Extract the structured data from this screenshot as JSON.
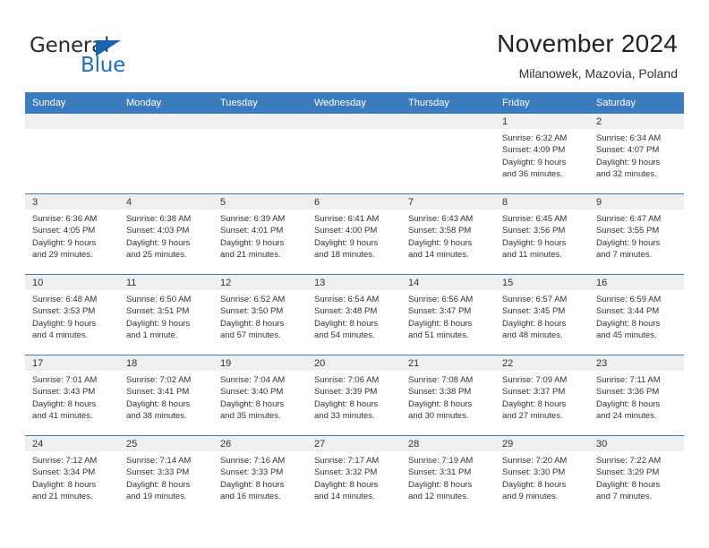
{
  "logo": {
    "word_general": "General",
    "word_blue": "Blue"
  },
  "header": {
    "title": "November 2024",
    "subtitle": "Milanowek, Mazovia, Poland"
  },
  "weekday_headers": [
    "Sunday",
    "Monday",
    "Tuesday",
    "Wednesday",
    "Thursday",
    "Friday",
    "Saturday"
  ],
  "colors": {
    "header_blue": "#3a7cbd",
    "logo_blue": "#1b6fc0",
    "daynum_band": "#efefef",
    "text": "#333333"
  },
  "weeks": [
    [
      {
        "day": "",
        "sunrise": "",
        "sunset": "",
        "daylight_line1": "",
        "daylight_line2": ""
      },
      {
        "day": "",
        "sunrise": "",
        "sunset": "",
        "daylight_line1": "",
        "daylight_line2": ""
      },
      {
        "day": "",
        "sunrise": "",
        "sunset": "",
        "daylight_line1": "",
        "daylight_line2": ""
      },
      {
        "day": "",
        "sunrise": "",
        "sunset": "",
        "daylight_line1": "",
        "daylight_line2": ""
      },
      {
        "day": "",
        "sunrise": "",
        "sunset": "",
        "daylight_line1": "",
        "daylight_line2": ""
      },
      {
        "day": "1",
        "sunrise": "Sunrise: 6:32 AM",
        "sunset": "Sunset: 4:09 PM",
        "daylight_line1": "Daylight: 9 hours",
        "daylight_line2": "and 36 minutes."
      },
      {
        "day": "2",
        "sunrise": "Sunrise: 6:34 AM",
        "sunset": "Sunset: 4:07 PM",
        "daylight_line1": "Daylight: 9 hours",
        "daylight_line2": "and 32 minutes."
      }
    ],
    [
      {
        "day": "3",
        "sunrise": "Sunrise: 6:36 AM",
        "sunset": "Sunset: 4:05 PM",
        "daylight_line1": "Daylight: 9 hours",
        "daylight_line2": "and 29 minutes."
      },
      {
        "day": "4",
        "sunrise": "Sunrise: 6:38 AM",
        "sunset": "Sunset: 4:03 PM",
        "daylight_line1": "Daylight: 9 hours",
        "daylight_line2": "and 25 minutes."
      },
      {
        "day": "5",
        "sunrise": "Sunrise: 6:39 AM",
        "sunset": "Sunset: 4:01 PM",
        "daylight_line1": "Daylight: 9 hours",
        "daylight_line2": "and 21 minutes."
      },
      {
        "day": "6",
        "sunrise": "Sunrise: 6:41 AM",
        "sunset": "Sunset: 4:00 PM",
        "daylight_line1": "Daylight: 9 hours",
        "daylight_line2": "and 18 minutes."
      },
      {
        "day": "7",
        "sunrise": "Sunrise: 6:43 AM",
        "sunset": "Sunset: 3:58 PM",
        "daylight_line1": "Daylight: 9 hours",
        "daylight_line2": "and 14 minutes."
      },
      {
        "day": "8",
        "sunrise": "Sunrise: 6:45 AM",
        "sunset": "Sunset: 3:56 PM",
        "daylight_line1": "Daylight: 9 hours",
        "daylight_line2": "and 11 minutes."
      },
      {
        "day": "9",
        "sunrise": "Sunrise: 6:47 AM",
        "sunset": "Sunset: 3:55 PM",
        "daylight_line1": "Daylight: 9 hours",
        "daylight_line2": "and 7 minutes."
      }
    ],
    [
      {
        "day": "10",
        "sunrise": "Sunrise: 6:48 AM",
        "sunset": "Sunset: 3:53 PM",
        "daylight_line1": "Daylight: 9 hours",
        "daylight_line2": "and 4 minutes."
      },
      {
        "day": "11",
        "sunrise": "Sunrise: 6:50 AM",
        "sunset": "Sunset: 3:51 PM",
        "daylight_line1": "Daylight: 9 hours",
        "daylight_line2": "and 1 minute."
      },
      {
        "day": "12",
        "sunrise": "Sunrise: 6:52 AM",
        "sunset": "Sunset: 3:50 PM",
        "daylight_line1": "Daylight: 8 hours",
        "daylight_line2": "and 57 minutes."
      },
      {
        "day": "13",
        "sunrise": "Sunrise: 6:54 AM",
        "sunset": "Sunset: 3:48 PM",
        "daylight_line1": "Daylight: 8 hours",
        "daylight_line2": "and 54 minutes."
      },
      {
        "day": "14",
        "sunrise": "Sunrise: 6:56 AM",
        "sunset": "Sunset: 3:47 PM",
        "daylight_line1": "Daylight: 8 hours",
        "daylight_line2": "and 51 minutes."
      },
      {
        "day": "15",
        "sunrise": "Sunrise: 6:57 AM",
        "sunset": "Sunset: 3:45 PM",
        "daylight_line1": "Daylight: 8 hours",
        "daylight_line2": "and 48 minutes."
      },
      {
        "day": "16",
        "sunrise": "Sunrise: 6:59 AM",
        "sunset": "Sunset: 3:44 PM",
        "daylight_line1": "Daylight: 8 hours",
        "daylight_line2": "and 45 minutes."
      }
    ],
    [
      {
        "day": "17",
        "sunrise": "Sunrise: 7:01 AM",
        "sunset": "Sunset: 3:43 PM",
        "daylight_line1": "Daylight: 8 hours",
        "daylight_line2": "and 41 minutes."
      },
      {
        "day": "18",
        "sunrise": "Sunrise: 7:02 AM",
        "sunset": "Sunset: 3:41 PM",
        "daylight_line1": "Daylight: 8 hours",
        "daylight_line2": "and 38 minutes."
      },
      {
        "day": "19",
        "sunrise": "Sunrise: 7:04 AM",
        "sunset": "Sunset: 3:40 PM",
        "daylight_line1": "Daylight: 8 hours",
        "daylight_line2": "and 35 minutes."
      },
      {
        "day": "20",
        "sunrise": "Sunrise: 7:06 AM",
        "sunset": "Sunset: 3:39 PM",
        "daylight_line1": "Daylight: 8 hours",
        "daylight_line2": "and 33 minutes."
      },
      {
        "day": "21",
        "sunrise": "Sunrise: 7:08 AM",
        "sunset": "Sunset: 3:38 PM",
        "daylight_line1": "Daylight: 8 hours",
        "daylight_line2": "and 30 minutes."
      },
      {
        "day": "22",
        "sunrise": "Sunrise: 7:09 AM",
        "sunset": "Sunset: 3:37 PM",
        "daylight_line1": "Daylight: 8 hours",
        "daylight_line2": "and 27 minutes."
      },
      {
        "day": "23",
        "sunrise": "Sunrise: 7:11 AM",
        "sunset": "Sunset: 3:36 PM",
        "daylight_line1": "Daylight: 8 hours",
        "daylight_line2": "and 24 minutes."
      }
    ],
    [
      {
        "day": "24",
        "sunrise": "Sunrise: 7:12 AM",
        "sunset": "Sunset: 3:34 PM",
        "daylight_line1": "Daylight: 8 hours",
        "daylight_line2": "and 21 minutes."
      },
      {
        "day": "25",
        "sunrise": "Sunrise: 7:14 AM",
        "sunset": "Sunset: 3:33 PM",
        "daylight_line1": "Daylight: 8 hours",
        "daylight_line2": "and 19 minutes."
      },
      {
        "day": "26",
        "sunrise": "Sunrise: 7:16 AM",
        "sunset": "Sunset: 3:33 PM",
        "daylight_line1": "Daylight: 8 hours",
        "daylight_line2": "and 16 minutes."
      },
      {
        "day": "27",
        "sunrise": "Sunrise: 7:17 AM",
        "sunset": "Sunset: 3:32 PM",
        "daylight_line1": "Daylight: 8 hours",
        "daylight_line2": "and 14 minutes."
      },
      {
        "day": "28",
        "sunrise": "Sunrise: 7:19 AM",
        "sunset": "Sunset: 3:31 PM",
        "daylight_line1": "Daylight: 8 hours",
        "daylight_line2": "and 12 minutes."
      },
      {
        "day": "29",
        "sunrise": "Sunrise: 7:20 AM",
        "sunset": "Sunset: 3:30 PM",
        "daylight_line1": "Daylight: 8 hours",
        "daylight_line2": "and 9 minutes."
      },
      {
        "day": "30",
        "sunrise": "Sunrise: 7:22 AM",
        "sunset": "Sunset: 3:29 PM",
        "daylight_line1": "Daylight: 8 hours",
        "daylight_line2": "and 7 minutes."
      }
    ]
  ]
}
